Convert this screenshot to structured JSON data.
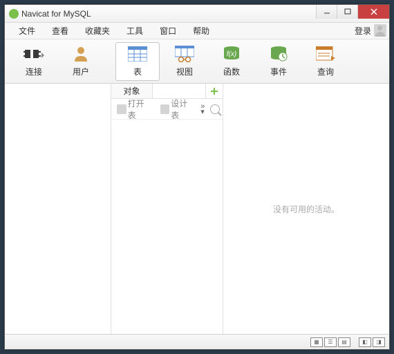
{
  "title": "Navicat for MySQL",
  "menu": {
    "file": "文件",
    "view": "查看",
    "fav": "收藏夹",
    "tools": "工具",
    "window": "窗口",
    "help": "帮助"
  },
  "login": "登录",
  "toolbar": {
    "connect": "连接",
    "user": "用户",
    "table": "表",
    "view": "视图",
    "func": "函数",
    "event": "事件",
    "query": "查询"
  },
  "tabs": {
    "object": "对象"
  },
  "mid_toolbar": {
    "open": "打开表",
    "design": "设计表"
  },
  "right_msg": "没有可用的活动。"
}
